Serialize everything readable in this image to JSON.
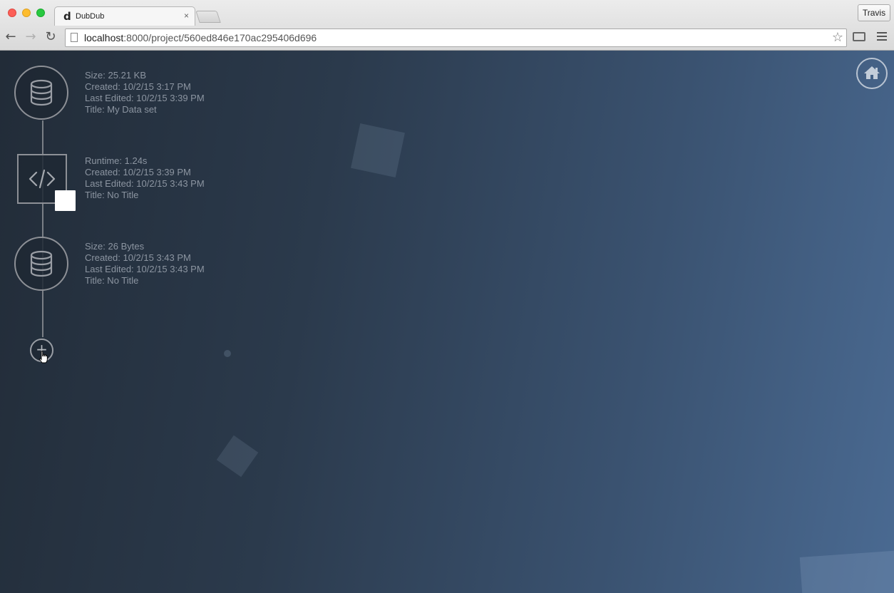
{
  "browser": {
    "tab_title": "DubDub",
    "tab_favicon": "d",
    "tab_close": "×",
    "profile_name": "Travis",
    "url_host": "localhost",
    "url_rest": ":8000/project/560ed846e170ac295406d696",
    "icons": [
      "back-arrow-icon",
      "forward-arrow-icon",
      "reload-icon",
      "page-icon",
      "bookmark-star-icon",
      "cast-icon",
      "menu-icon"
    ]
  },
  "pipeline": {
    "nodes": [
      {
        "kind": "dataset",
        "icon": "database-icon",
        "lines": [
          "Size: 25.21 KB",
          "Created: 10/2/15 3:17 PM",
          "Last Edited: 10/2/15 3:39 PM",
          "Title: My Data set"
        ]
      },
      {
        "kind": "script",
        "icon": "code-icon",
        "lines": [
          "Runtime: 1.24s",
          "Created: 10/2/15 3:39 PM",
          "Last Edited: 10/2/15 3:43 PM",
          "Title: No Title"
        ]
      },
      {
        "kind": "dataset",
        "icon": "database-icon",
        "lines": [
          "Size: 26 Bytes",
          "Created: 10/2/15 3:43 PM",
          "Last Edited: 10/2/15 3:43 PM",
          "Title: No Title"
        ]
      }
    ],
    "add_label": "+"
  },
  "colors": {
    "accent_line": "#7a7f86",
    "info_text": "#8c95a1"
  }
}
